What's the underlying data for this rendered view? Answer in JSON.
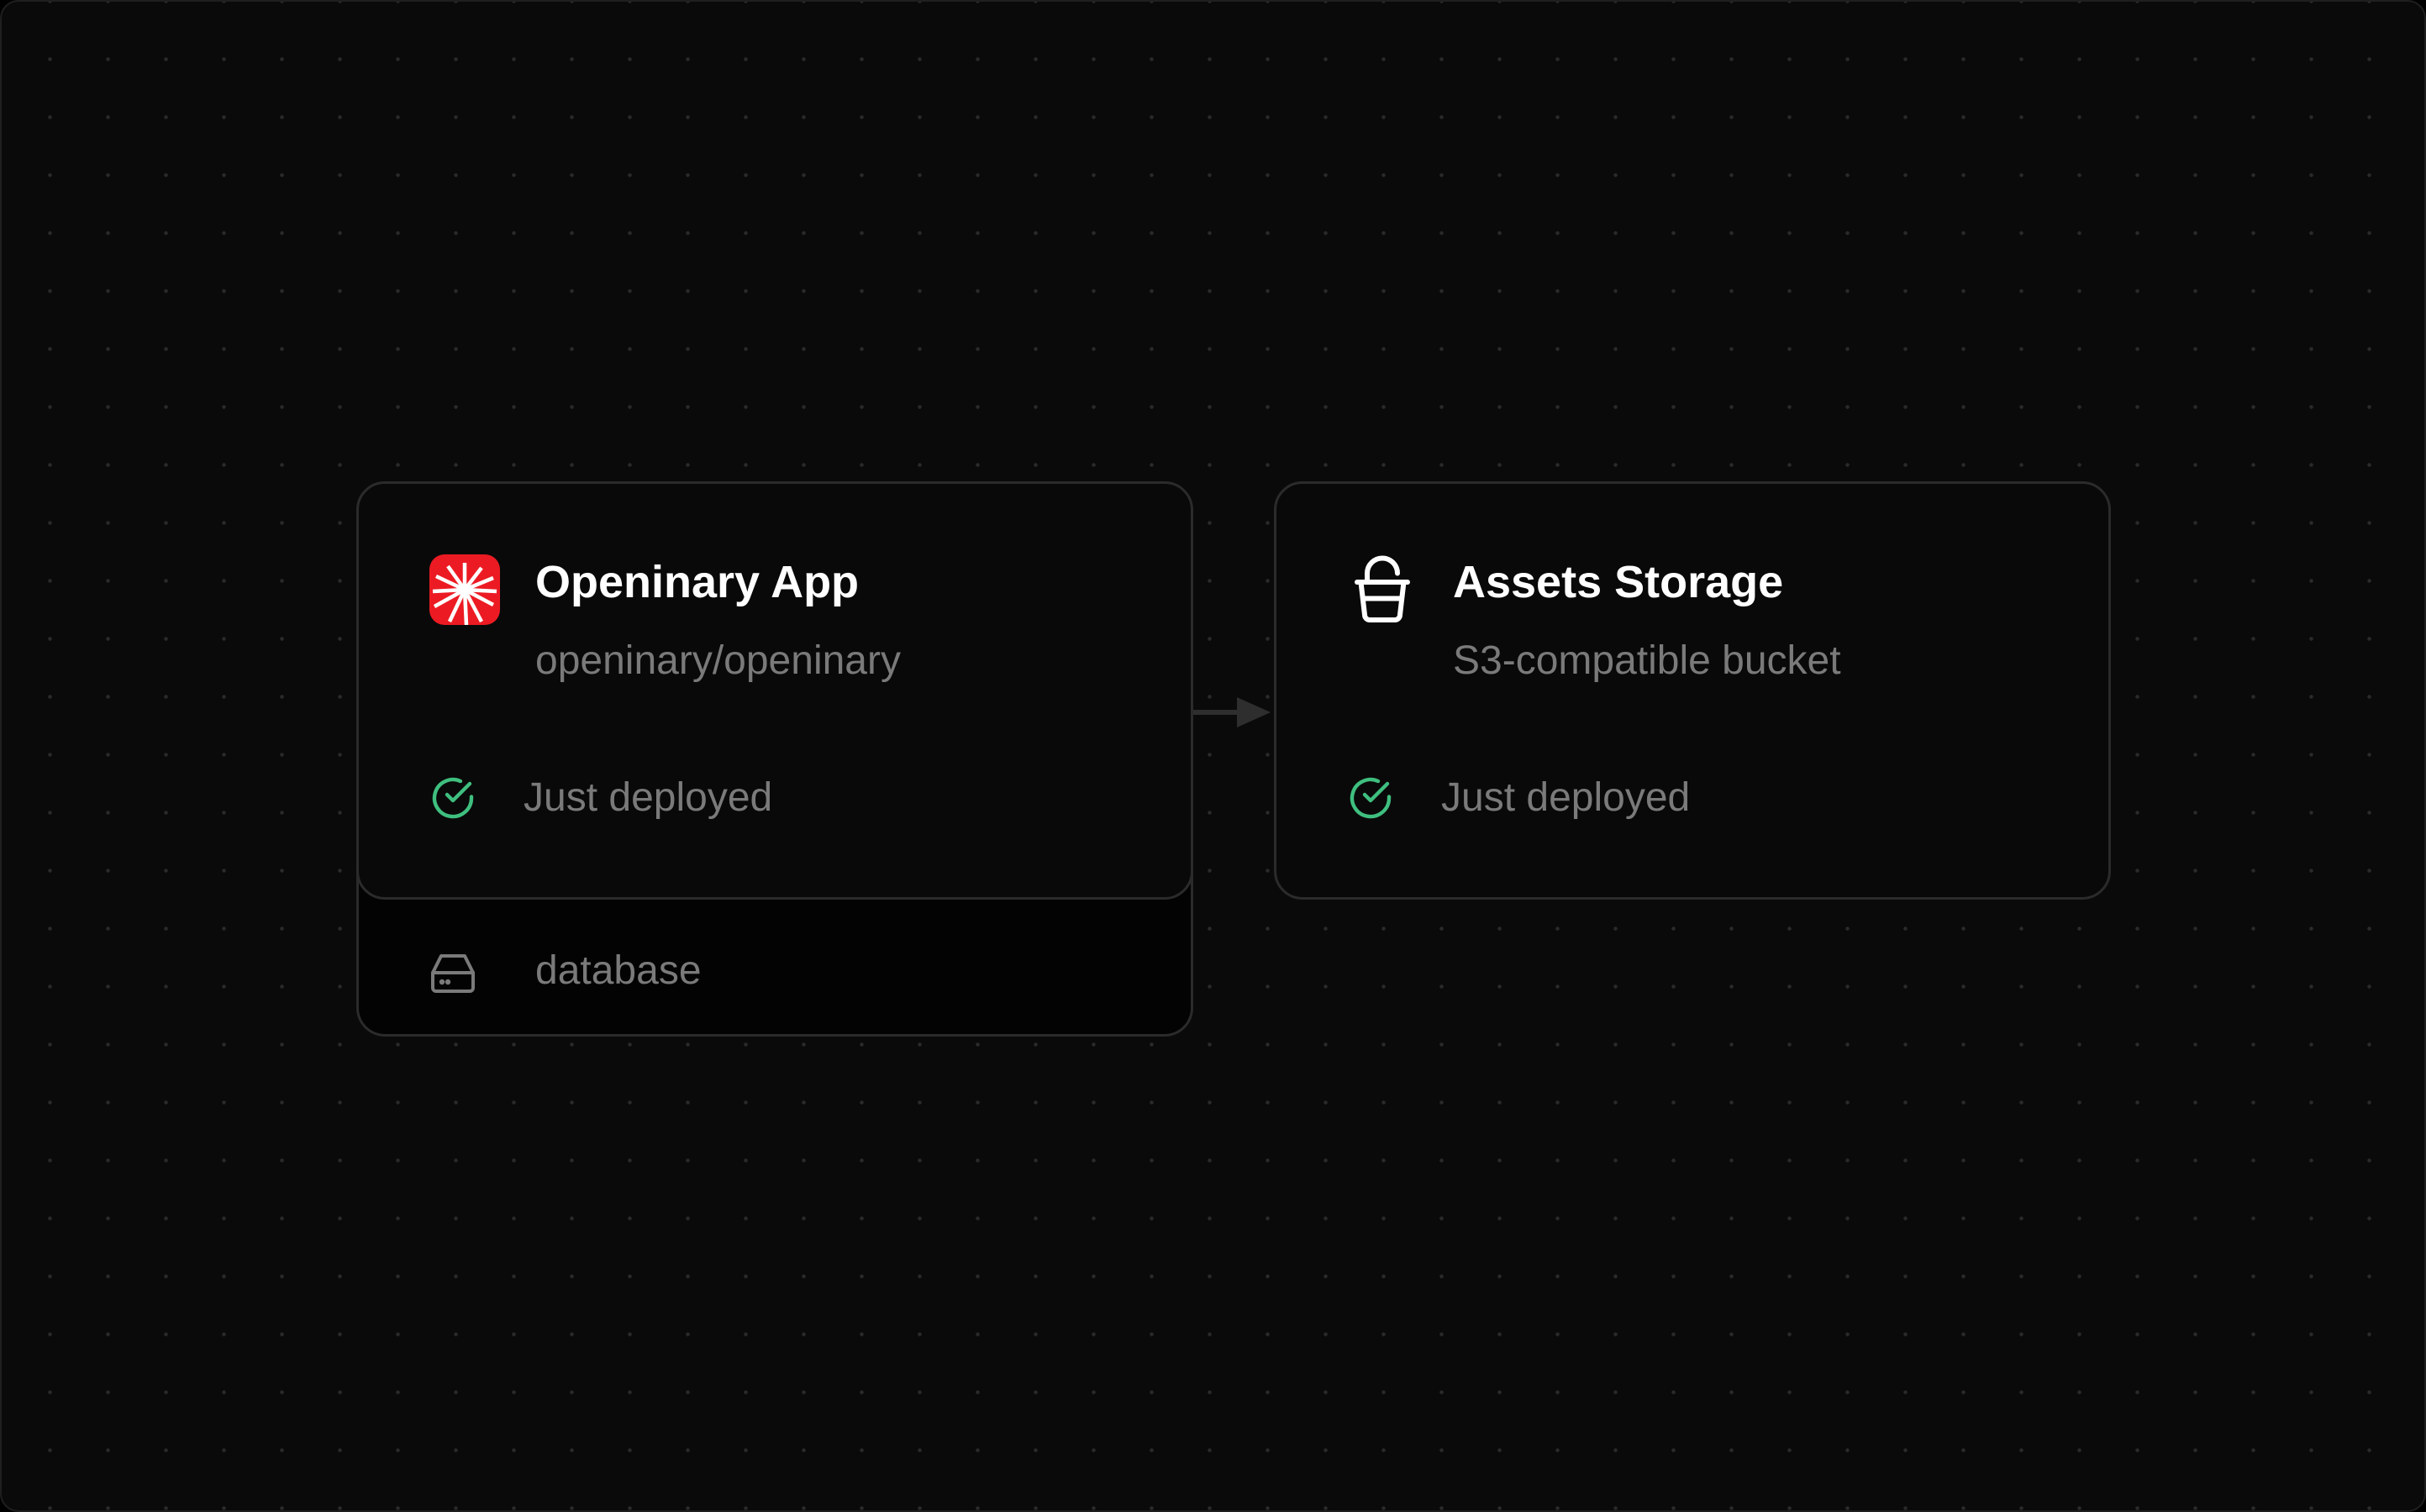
{
  "services": [
    {
      "title": "Openinary App",
      "subtitle": "openinary/openinary",
      "status": "Just deployed",
      "icon": "openinary-logo-icon",
      "attached_volume": {
        "label": "database",
        "icon": "hard-drive-icon"
      }
    },
    {
      "title": "Assets Storage",
      "subtitle": "S3-compatible bucket",
      "status": "Just deployed",
      "icon": "bucket-icon"
    }
  ],
  "connection": {
    "from": "Openinary App",
    "to": "Assets Storage"
  },
  "colors": {
    "background": "#0a0a0a",
    "card_background": "#090909",
    "card_border": "#2b2b2b",
    "title": "#ffffff",
    "muted_text": "#7a7a7a",
    "status_success": "#3fbf7f",
    "app_logo": "#ec1b23"
  }
}
